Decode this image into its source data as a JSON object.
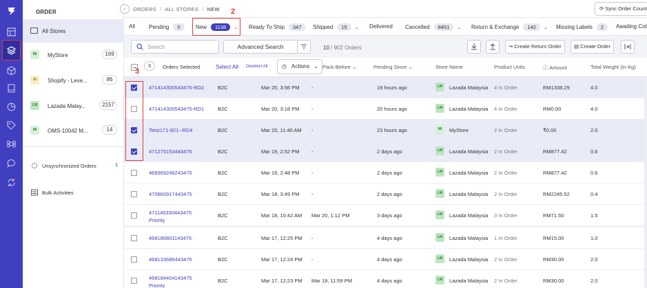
{
  "annotations": {
    "new_tab_marker": "2",
    "select_marker": "3"
  },
  "sidebar": {
    "heading": "ORDER",
    "all_stores_label": "All Stores",
    "stores": [
      {
        "badge": "MI",
        "name": "MyStore",
        "count": "169",
        "badge_color": "#d6f0d8"
      },
      {
        "badge": "SI",
        "name": "Shopify - Leve...",
        "count": "86",
        "badge_color": "#f7efc4"
      },
      {
        "badge": "LM",
        "name": "Lazada Malay...",
        "count": "2157",
        "badge_color": "#bfe6c3"
      },
      {
        "badge": "MI",
        "name": "OMS-10042 M...",
        "count": "14",
        "badge_color": "#d6f0d8"
      }
    ],
    "unsynced_label": "Unsynchronized Orders",
    "unsynced_count": "1",
    "bulk_label": "Bulk Activities"
  },
  "breadcrumb": {
    "level1": "ORDERS",
    "level2": "ALL STORES",
    "level3": "NEW"
  },
  "sync_button": "Sync Order Counts",
  "tabs": [
    {
      "label": "All",
      "count": ""
    },
    {
      "label": "Pending",
      "count": "0"
    },
    {
      "label": "New",
      "count": "1138"
    },
    {
      "label": "Ready To Ship",
      "count": "347"
    },
    {
      "label": "Shipped",
      "count": "15"
    },
    {
      "label": "Delivered",
      "count": ""
    },
    {
      "label": "Cancelled",
      "count": "8451"
    },
    {
      "label": "Return & Exchange",
      "count": "142"
    },
    {
      "label": "Missing Labels",
      "count": "2"
    },
    {
      "label": "Awaiting Coll",
      "count": ""
    }
  ],
  "toolbar": {
    "search_placeholder": "Search",
    "advanced_search": "Advanced Search",
    "page_count_shown": "10",
    "page_count_total": " / 902 Orders",
    "create_return_order": "Create Return Order",
    "create_order": "Create Order"
  },
  "table_header": {
    "selected_count": "3",
    "orders_selected": "Orders Selected",
    "select_all": "Select All",
    "deselect_all": "Deselect All",
    "actions": "Actions",
    "pack_before": "Pack Before",
    "pending_since": "Pending Since",
    "store_name": "Store Name",
    "product_units": "Product Units",
    "amount": "Amount",
    "total_weight": "Total Weight (In Kg)"
  },
  "rows": [
    {
      "checked": true,
      "id": "471414300543475-RD2",
      "id2": "",
      "type": "B2C",
      "date": "Mar 20, 3:56 PM",
      "pack_before": "-",
      "pending": "19 hours ago",
      "store_badge": "LM",
      "store": "Lazada Malaysia",
      "units": "4 In Order",
      "amount": "RM1338.29",
      "weight": "4.0"
    },
    {
      "checked": false,
      "id": "471414300543475-RD1",
      "id2": "",
      "type": "B2C",
      "date": "Mar 20, 3:18 PM",
      "pack_before": "-",
      "pending": "20 hours ago",
      "store_badge": "LM",
      "store": "Lazada Malaysia",
      "units": "4 In Order",
      "amount": "RM0.00",
      "weight": "4.0"
    },
    {
      "checked": true,
      "id": "Tetst171-821--RD4",
      "id2": "",
      "type": "B2C",
      "date": "Mar 20, 11:40 AM",
      "pack_before": "-",
      "pending": "23 hours ago",
      "store_badge": "MI",
      "store": "MyStore",
      "units": "2 In Order",
      "amount": "₹0.00",
      "weight": "2.0"
    },
    {
      "checked": true,
      "id": "471275153443475",
      "id2": "",
      "type": "B2C",
      "date": "Mar 19, 2:52 PM",
      "pack_before": "-",
      "pending": "2 days ago",
      "store_badge": "LM",
      "store": "Lazada Malaysia",
      "units": "2 In Order",
      "amount": "RM877.42",
      "weight": "0.6"
    },
    {
      "checked": false,
      "id": "468369249243475",
      "id2": "",
      "type": "B2C",
      "date": "Mar 19, 2:48 PM",
      "pack_before": "-",
      "pending": "2 days ago",
      "store_badge": "LM",
      "store": "Lazada Malaysia",
      "units": "2 In Order",
      "amount": "RM877.42",
      "weight": "0.6"
    },
    {
      "checked": false,
      "id": "470860917443475",
      "id2": "",
      "type": "B2C",
      "date": "Mar 18, 3:49 PM",
      "pack_before": "-",
      "pending": "2 days ago",
      "store_badge": "LM",
      "store": "Lazada Malaysia",
      "units": "2 In Order",
      "amount": "RM2245.52",
      "weight": "0.4"
    },
    {
      "checked": false,
      "id": "471146330443475",
      "id2": "Priority",
      "type": "B2C",
      "date": "Mar 18, 10:42 AM",
      "pack_before": "Mar 20, 1:12 PM",
      "pending": "3 days ago",
      "store_badge": "LM",
      "store": "Lazada Malaysia",
      "units": "3 In Order",
      "amount": "RM71.50",
      "weight": "1.5"
    },
    {
      "checked": false,
      "id": "468186801143475",
      "id2": "",
      "type": "B2C",
      "date": "Mar 17, 12:25 PM",
      "pack_before": "-",
      "pending": "4 days ago",
      "store_badge": "LM",
      "store": "Lazada Malaysia",
      "units": "1 In Order",
      "amount": "RM15.00",
      "weight": "1.0"
    },
    {
      "checked": false,
      "id": "468133686443475",
      "id2": "",
      "type": "B2C",
      "date": "Mar 17, 12:24 PM",
      "pack_before": "-",
      "pending": "4 days ago",
      "store_badge": "LM",
      "store": "Lazada Malaysia",
      "units": "2 In Order",
      "amount": "RM30.00",
      "weight": "2.0"
    },
    {
      "checked": false,
      "id": "468184404143475",
      "id2": "Priority",
      "type": "B2C",
      "date": "Mar 17, 12:23 PM",
      "pack_before": "Mar 19, 11:59 PM",
      "pending": "4 days ago",
      "store_badge": "LM",
      "store": "Lazada Malaysia",
      "units": "2 In Order",
      "amount": "RM30.00",
      "weight": "2.0"
    }
  ],
  "colors": {
    "rail": "#3f3fbf",
    "accent": "#3f3fbf",
    "annotation": "#e53935",
    "selected_row": "#e9ebf7"
  }
}
